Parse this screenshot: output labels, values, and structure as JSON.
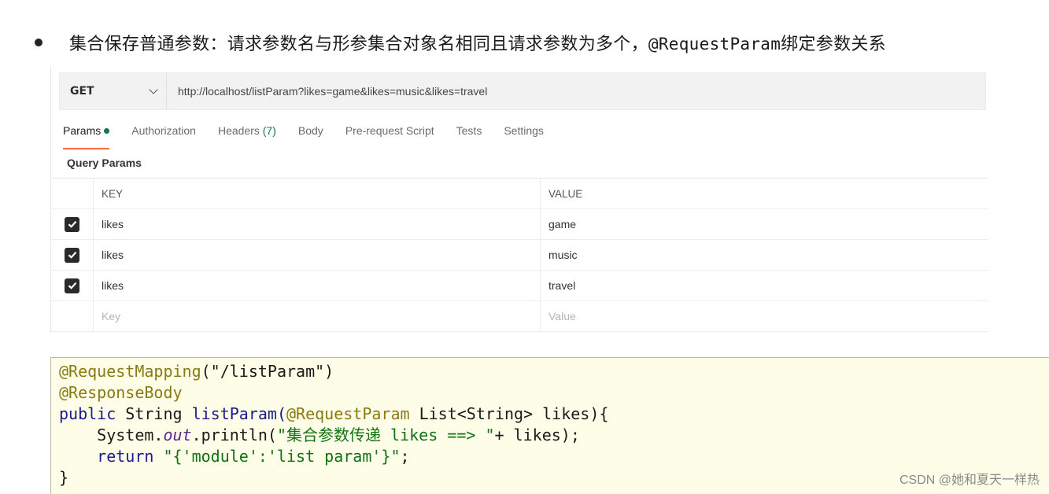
{
  "heading": {
    "text_before": "集合保存普通参数：请求参数名与形参集合对象名相同且请求参数为多个，",
    "mono_text": "@RequestParam",
    "text_after": "绑定参数关系"
  },
  "request": {
    "method": "GET",
    "url": "http://localhost/listParam?likes=game&likes=music&likes=travel"
  },
  "tabs": [
    {
      "label": "Params",
      "active": true
    },
    {
      "label": "Authorization"
    },
    {
      "label": "Headers",
      "count": "(7)"
    },
    {
      "label": "Body"
    },
    {
      "label": "Pre-request Script"
    },
    {
      "label": "Tests"
    },
    {
      "label": "Settings"
    }
  ],
  "query_params": {
    "label": "Query Params",
    "headers": {
      "key": "KEY",
      "value": "VALUE"
    },
    "rows": [
      {
        "key": "likes",
        "value": "game",
        "checked": true
      },
      {
        "key": "likes",
        "value": "music",
        "checked": true
      },
      {
        "key": "likes",
        "value": "travel",
        "checked": true
      }
    ],
    "placeholder": {
      "key": "Key",
      "value": "Value"
    }
  },
  "code": {
    "line1_ann": "@RequestMapping",
    "line1_rest": "(\"/listParam\")",
    "line2_ann": "@ResponseBody",
    "line3_kw": "public",
    "line3_a": " String ",
    "line3_method": "listParam(",
    "line3_ann": "@RequestParam",
    "line3_rest": " List<String> likes){",
    "line4_a": "    System.",
    "line4_out": "out",
    "line4_b": ".println(",
    "line4_str": "\"集合参数传递 likes ==> \"",
    "line4_c": "+ likes);",
    "line5_kw": "    return",
    "line5_str": " \"{'module':'list param'}\"",
    "line5_end": ";",
    "line6": "}"
  },
  "watermark": "CSDN @她和夏天一样热",
  "colors": {
    "accent": "#ff6c37",
    "status_dot": "#0b7a4b"
  }
}
